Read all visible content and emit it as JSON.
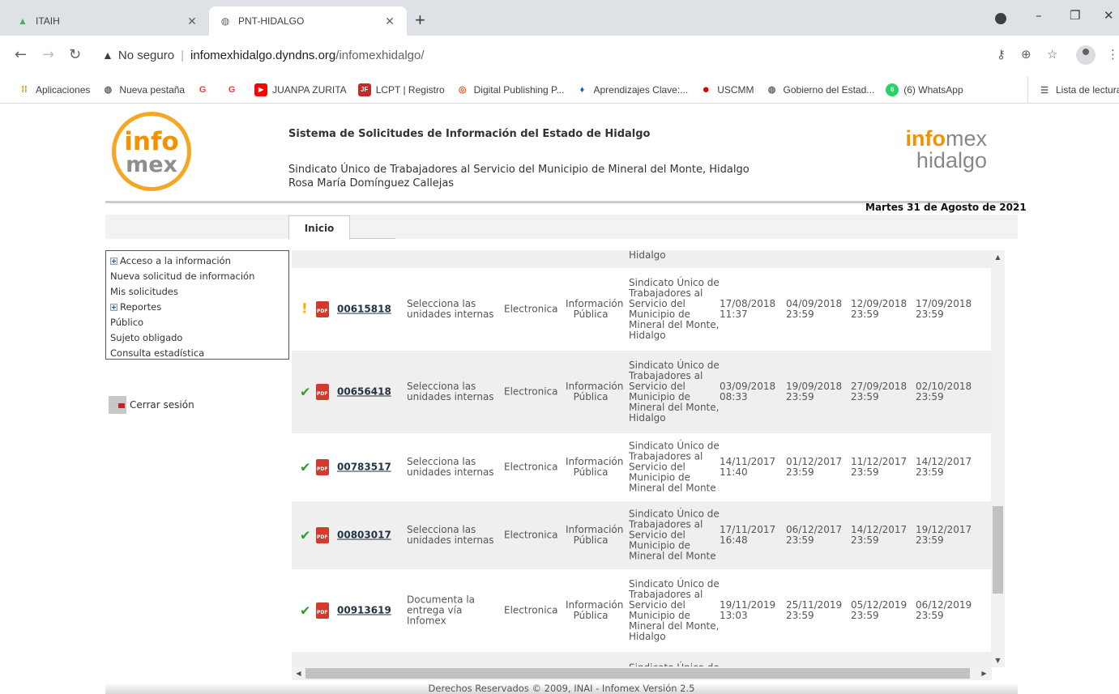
{
  "browser": {
    "tabs": [
      {
        "title": "ITAIH",
        "active": false
      },
      {
        "title": "PNT-HIDALGO",
        "active": true
      }
    ],
    "new_tab": "+",
    "address": {
      "warning": "No seguro",
      "host": "infomexhidalgo.dyndns.org",
      "path": "/infomexhidalgo/"
    },
    "bookmarks": [
      {
        "label": "Aplicaciones",
        "icon": "apps-grid-icon",
        "color": "#e8710a"
      },
      {
        "label": "Nueva pestaña",
        "icon": "globe-icon",
        "color": "#5f6368"
      },
      {
        "label": "",
        "icon": "google-icon",
        "color": "#ea4335"
      },
      {
        "label": "",
        "icon": "google-icon",
        "color": "#ea4335"
      },
      {
        "label": "JUANPA ZURITA",
        "icon": "youtube-icon",
        "color": "#ff0000"
      },
      {
        "label": "LCPT | Registro",
        "icon": "lcpt-icon",
        "color": "#c62828"
      },
      {
        "label": "Digital Publishing P...",
        "icon": "target-icon",
        "color": "#f4511e"
      },
      {
        "label": "Aprendizajes Clave:...",
        "icon": "pin-icon",
        "color": "#1565c0"
      },
      {
        "label": "USCMM",
        "icon": "red-circle-icon",
        "color": "#d50000"
      },
      {
        "label": "Gobierno del Estad...",
        "icon": "globe-icon",
        "color": "#5f6368"
      },
      {
        "label": "(6) WhatsApp",
        "icon": "whatsapp-icon",
        "color": "#25d366"
      }
    ],
    "reading_list": "Lista de lectura"
  },
  "header": {
    "logo_left_top": "info",
    "logo_left_bottom": "mex",
    "system_title": "Sistema de Solicitudes de Información del Estado de Hidalgo",
    "entity": "Sindicato Único de Trabajadores al Servicio del Municipio de Mineral del Monte, Hidalgo",
    "user": "Rosa María Domínguez Callejas",
    "logo_right_a": "info",
    "logo_right_b": "mex",
    "logo_right_c": "hidalgo",
    "date": "Martes 31 de Agosto de 2021",
    "tab_home": "Inicio"
  },
  "sidebar": {
    "items": [
      {
        "label": "Acceso a la información",
        "expander": true
      },
      {
        "label": "Nueva solicitud de información",
        "expander": false
      },
      {
        "label": "Mis solicitudes",
        "expander": false
      },
      {
        "label": "Reportes",
        "expander": true
      },
      {
        "label": "Público",
        "expander": false
      },
      {
        "label": "Sujeto obligado",
        "expander": false
      },
      {
        "label": "Consulta estadística",
        "expander": false
      }
    ],
    "logout": "Cerrar sesión"
  },
  "grid": {
    "rows": [
      {
        "status": "",
        "folio": "",
        "etapa": "",
        "medio": "",
        "tipo": "",
        "sujeto": "Mineral del Monte,\nHidalgo",
        "d1": "",
        "d2": "",
        "d3": "",
        "d4": ""
      },
      {
        "status": "warn",
        "folio": "00615818",
        "etapa": "Selecciona las unidades internas",
        "medio": "Electronica",
        "tipo": "Información Pública",
        "sujeto": "Sindicato Único de Trabajadores al Servicio del Municipio de Mineral del Monte, Hidalgo",
        "d1": "17/08/2018 11:37",
        "d2": "04/09/2018 23:59",
        "d3": "12/09/2018 23:59",
        "d4": "17/09/2018 23:59"
      },
      {
        "status": "ok",
        "folio": "00656418",
        "etapa": "Selecciona las unidades internas",
        "medio": "Electronica",
        "tipo": "Información Pública",
        "sujeto": "Sindicato Único de Trabajadores al Servicio del Municipio de Mineral del Monte, Hidalgo",
        "d1": "03/09/2018 08:33",
        "d2": "19/09/2018 23:59",
        "d3": "27/09/2018 23:59",
        "d4": "02/10/2018 23:59"
      },
      {
        "status": "ok",
        "folio": "00783517",
        "etapa": "Selecciona las unidades internas",
        "medio": "Electronica",
        "tipo": "Información Pública",
        "sujeto": "Sindicato Único de Trabajadores al Servicio del Municipio de Mineral del Monte",
        "d1": "14/11/2017 11:40",
        "d2": "01/12/2017 23:59",
        "d3": "11/12/2017 23:59",
        "d4": "14/12/2017 23:59"
      },
      {
        "status": "ok",
        "folio": "00803017",
        "etapa": "Selecciona las unidades internas",
        "medio": "Electronica",
        "tipo": "Información Pública",
        "sujeto": "Sindicato Único de Trabajadores al Servicio del Municipio de Mineral del Monte",
        "d1": "17/11/2017 16:48",
        "d2": "06/12/2017 23:59",
        "d3": "14/12/2017 23:59",
        "d4": "19/12/2017 23:59"
      },
      {
        "status": "ok",
        "folio": "00913619",
        "etapa": "Documenta la entrega vía Infomex",
        "medio": "Electronica",
        "tipo": "Información Pública",
        "sujeto": "Sindicato Único de Trabajadores al Servicio del Municipio de Mineral del Monte, Hidalgo",
        "d1": "19/11/2019 13:03",
        "d2": "25/11/2019 23:59",
        "d3": "05/12/2019 23:59",
        "d4": "06/12/2019 23:59"
      },
      {
        "status": "",
        "folio": "",
        "etapa": "",
        "medio": "",
        "tipo": "",
        "sujeto": "Sindicato Único de",
        "d1": "",
        "d2": "",
        "d3": "",
        "d4": ""
      }
    ]
  },
  "footer": "Derechos Reservados © 2009, INAI - Infomex Versión 2.5"
}
